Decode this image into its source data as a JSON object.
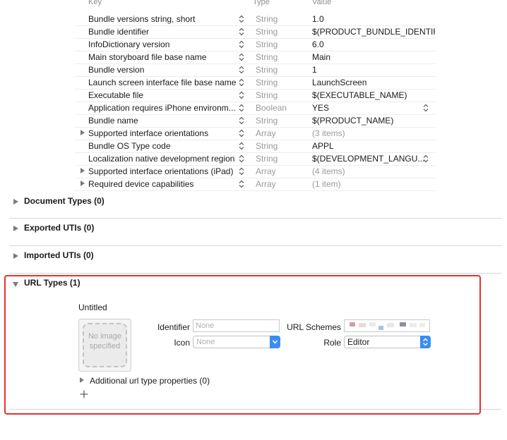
{
  "plist": {
    "headers": {
      "key": "Key",
      "type": "Type",
      "value": "Value"
    },
    "rows": [
      {
        "key": "Bundle versions string, short",
        "type": "String",
        "value": "1.0",
        "disclosure": false,
        "value_gray": false,
        "value_stepper": false
      },
      {
        "key": "Bundle identifier",
        "type": "String",
        "value": "$(PRODUCT_BUNDLE_IDENTIFIER)",
        "disclosure": false,
        "value_gray": false,
        "value_stepper": false
      },
      {
        "key": "InfoDictionary version",
        "type": "String",
        "value": "6.0",
        "disclosure": false,
        "value_gray": false,
        "value_stepper": false
      },
      {
        "key": "Main storyboard file base name",
        "type": "String",
        "value": "Main",
        "disclosure": false,
        "value_gray": false,
        "value_stepper": false
      },
      {
        "key": "Bundle version",
        "type": "String",
        "value": "1",
        "disclosure": false,
        "value_gray": false,
        "value_stepper": false
      },
      {
        "key": "Launch screen interface file base name",
        "type": "String",
        "value": "LaunchScreen",
        "disclosure": false,
        "value_gray": false,
        "value_stepper": false
      },
      {
        "key": "Executable file",
        "type": "String",
        "value": "$(EXECUTABLE_NAME)",
        "disclosure": false,
        "value_gray": false,
        "value_stepper": false
      },
      {
        "key": "Application requires iPhone environm...",
        "type": "Boolean",
        "value": "YES",
        "disclosure": false,
        "value_gray": false,
        "value_stepper": true
      },
      {
        "key": "Bundle name",
        "type": "String",
        "value": "$(PRODUCT_NAME)",
        "disclosure": false,
        "value_gray": false,
        "value_stepper": false
      },
      {
        "key": "Supported interface orientations",
        "type": "Array",
        "value": "(3 items)",
        "disclosure": true,
        "value_gray": true,
        "value_stepper": false
      },
      {
        "key": "Bundle OS Type code",
        "type": "String",
        "value": "APPL",
        "disclosure": false,
        "value_gray": false,
        "value_stepper": false
      },
      {
        "key": "Localization native development region",
        "type": "String",
        "value": "$(DEVELOPMENT_LANGU...",
        "disclosure": false,
        "value_gray": false,
        "value_stepper": true
      },
      {
        "key": "Supported interface orientations (iPad)",
        "type": "Array",
        "value": "(4 items)",
        "disclosure": true,
        "value_gray": true,
        "value_stepper": false
      },
      {
        "key": "Required device capabilities",
        "type": "Array",
        "value": "(1 item)",
        "disclosure": true,
        "value_gray": true,
        "value_stepper": false
      }
    ]
  },
  "sections": {
    "document_types": "Document Types (0)",
    "exported_utis": "Exported UTIs (0)",
    "imported_utis": "Imported UTIs (0)",
    "url_types": "URL Types (1)"
  },
  "url_type": {
    "name": "Untitled",
    "image_placeholder": "No image specified",
    "identifier_label": "Identifier",
    "identifier_placeholder": "None",
    "icon_label": "Icon",
    "icon_value": "None",
    "url_schemes_label": "URL Schemes",
    "role_label": "Role",
    "role_value": "Editor",
    "additional_properties": "Additional url type properties (0)",
    "add_icon": "plus-icon"
  },
  "colors": {
    "highlight_border": "#e8312f",
    "accent": "#3b8cf5"
  }
}
